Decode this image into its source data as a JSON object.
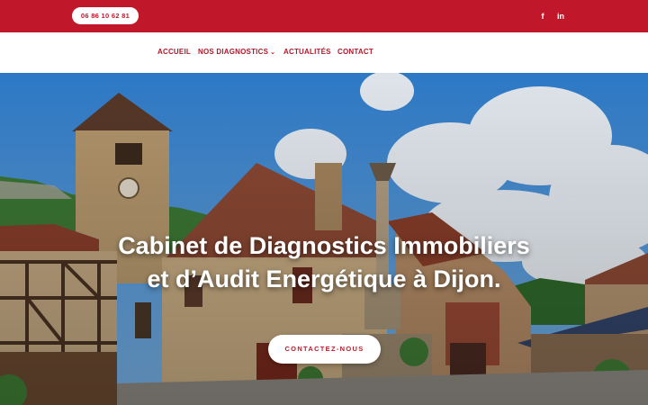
{
  "topbar": {
    "phone": "06 86 10 62 81",
    "social": [
      {
        "icon": "facebook-icon",
        "glyph": "f"
      },
      {
        "icon": "linkedin-icon",
        "glyph": "in"
      }
    ],
    "background_color": "#c0182a"
  },
  "nav": {
    "items": [
      {
        "label": "ACCUEIL"
      },
      {
        "label": "NOS DIAGNOSTICS",
        "has_dropdown": true,
        "dropdown_icon": "chevron-down-icon"
      },
      {
        "label": "ACTUALITÉS"
      },
      {
        "label": "CONTACT"
      }
    ],
    "text_color": "#b0182a"
  },
  "hero": {
    "title_line1": "Cabinet de Diagnostics Immobiliers",
    "title_line2": "et d’Audit Energétique à Dijon.",
    "cta_label": "CONTACTEZ-NOUS",
    "image": "village-street-with-clock-tower"
  }
}
